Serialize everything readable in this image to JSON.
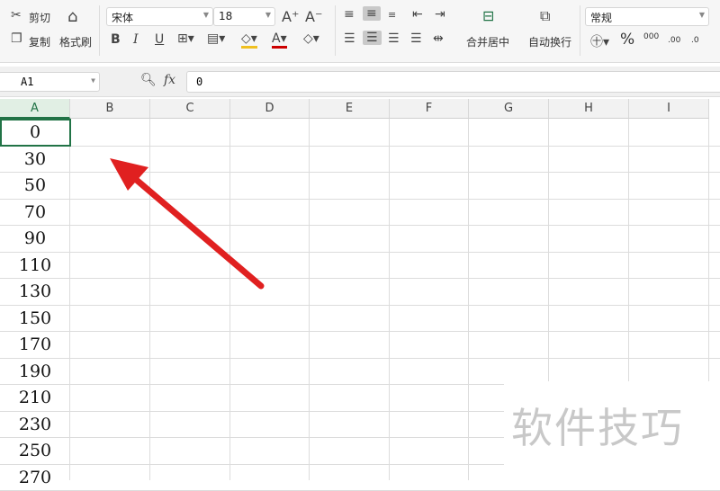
{
  "ribbon": {
    "cut": "剪切",
    "copy": "复制",
    "format_painter": "格式刷",
    "font_name": "宋体",
    "font_size": "18",
    "merge_center": "合并居中",
    "wrap_text": "自动换行",
    "number_format": "常规",
    "percent": "%",
    "thousands": "000",
    "inc_decimal": ".00",
    "dec_decimal": ".0"
  },
  "formula_bar": {
    "name_box": "A1",
    "fx": "fx",
    "value": "0"
  },
  "columns": [
    "A",
    "B",
    "C",
    "D",
    "E",
    "F",
    "G",
    "H",
    "I"
  ],
  "column_a_values": [
    "0",
    "30",
    "50",
    "70",
    "90",
    "110",
    "130",
    "150",
    "170",
    "190",
    "210",
    "230",
    "250",
    "270"
  ],
  "watermark": "软件技巧",
  "colors": {
    "accent": "#217346",
    "arrow": "#e02020"
  }
}
